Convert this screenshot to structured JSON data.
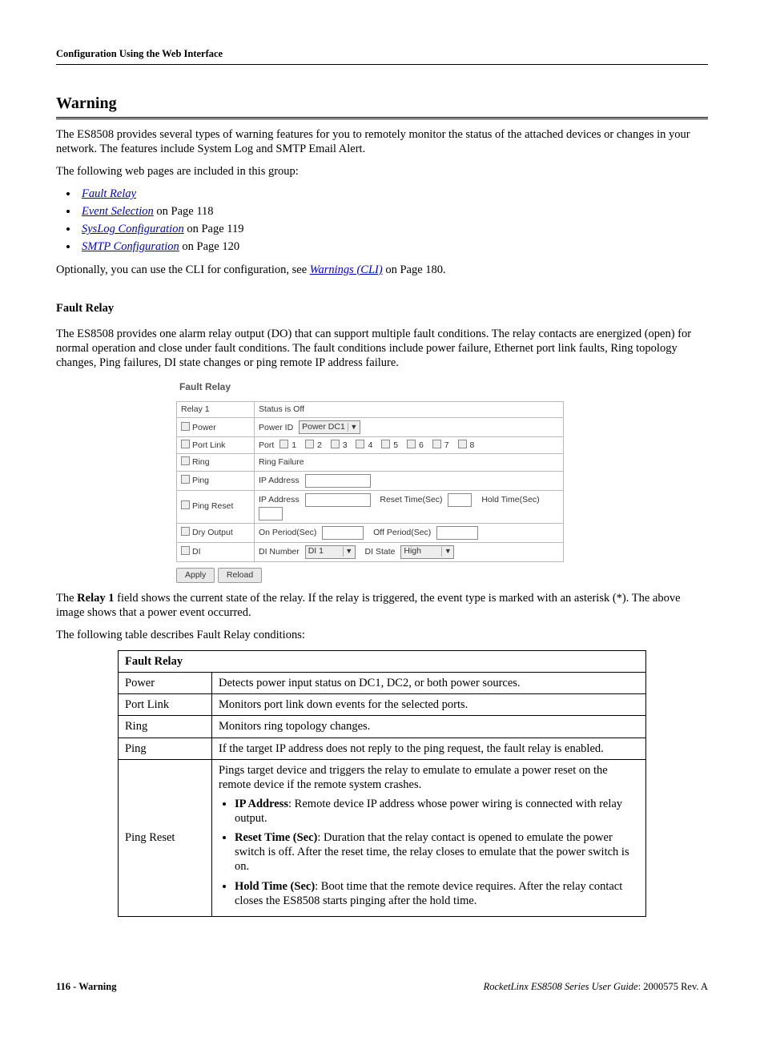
{
  "header": {
    "breadcrumb": "Configuration Using the Web Interface"
  },
  "title": "Warning",
  "para1": "The ES8508 provides several types of warning features for you to remotely monitor the status of the attached devices or changes in your network. The features include System Log and SMTP Email Alert.",
  "para2": "The following web pages are included in this group:",
  "bullets": [
    {
      "link": "Fault Relay",
      "rest": ""
    },
    {
      "link": "Event Selection",
      "rest": " on Page 118"
    },
    {
      "link": "SysLog Configuration",
      "rest": " on Page 119"
    },
    {
      "link": "SMTP Configuration",
      "rest": " on Page 120"
    }
  ],
  "para3_pre": "Optionally, you can use the CLI for configuration, see ",
  "para3_link": "Warnings (CLI)",
  "para3_post": " on Page 180.",
  "subsection": "Fault Relay",
  "para4": "The ES8508 provides one alarm relay output (DO) that can support multiple fault conditions. The relay contacts are energized (open) for normal operation and close under fault conditions. The fault conditions include power failure, Ethernet port link faults, Ring topology changes, Ping failures, DI state changes or ping remote IP address failure.",
  "ui": {
    "title": "Fault Relay",
    "relay_label": "Relay 1",
    "relay_status": "Status is Off",
    "rows": {
      "power": "Power",
      "portlink": "Port Link",
      "ring": "Ring",
      "ping": "Ping",
      "pingreset": "Ping Reset",
      "dryoutput": "Dry Output",
      "di": "DI"
    },
    "power_id_label": "Power ID",
    "power_id_value": "Power DC1",
    "port_label": "Port",
    "port_nums": [
      "1",
      "2",
      "3",
      "4",
      "5",
      "6",
      "7",
      "8"
    ],
    "ring_val": "Ring Failure",
    "ip_address_label": "IP Address",
    "reset_time_label": "Reset Time(Sec)",
    "hold_time_label": "Hold Time(Sec)",
    "on_period_label": "On Period(Sec)",
    "off_period_label": "Off Period(Sec)",
    "di_number_label": "DI Number",
    "di_number_value": "DI 1",
    "di_state_label": "DI State",
    "di_state_value": "High",
    "apply": "Apply",
    "reload": "Reload"
  },
  "para5_pre": "The ",
  "para5_bold": "Relay 1",
  "para5_post": " field shows the current state of the relay. If the relay is triggered, the event type is marked with an asterisk (*). The above image shows that a power event occurred.",
  "para6": "The following table describes Fault Relay conditions:",
  "desc_table": {
    "header": "Fault Relay",
    "rows": [
      {
        "name": "Power",
        "text": "Detects power input status on DC1, DC2, or both power sources."
      },
      {
        "name": "Port Link",
        "text": "Monitors port link down events for the selected ports."
      },
      {
        "name": "Ring",
        "text": "Monitors ring topology changes."
      },
      {
        "name": "Ping",
        "text": "If the target IP address does not reply to the ping request, the fault relay is enabled."
      }
    ],
    "pingreset": {
      "name": "Ping Reset",
      "lead": "Pings target device and triggers the relay to emulate to emulate a power reset on the remote device if the remote system crashes.",
      "items": [
        {
          "b": "IP Address",
          "rest": ": Remote device IP address whose power wiring is connected with relay output."
        },
        {
          "b": "Reset Time (Sec)",
          "rest": ": Duration that the relay contact is opened to emulate the power switch is off. After the reset time, the relay closes to emulate that the power switch is on."
        },
        {
          "b": "Hold Time (Sec)",
          "rest": ": Boot time that the remote device requires. After the relay contact closes the ES8508 starts pinging after the hold time."
        }
      ]
    }
  },
  "footer": {
    "left_page": "116 - Warning",
    "right_title": "RocketLinx ES8508 Series  User Guide",
    "right_rev": ": 2000575 Rev. A"
  }
}
